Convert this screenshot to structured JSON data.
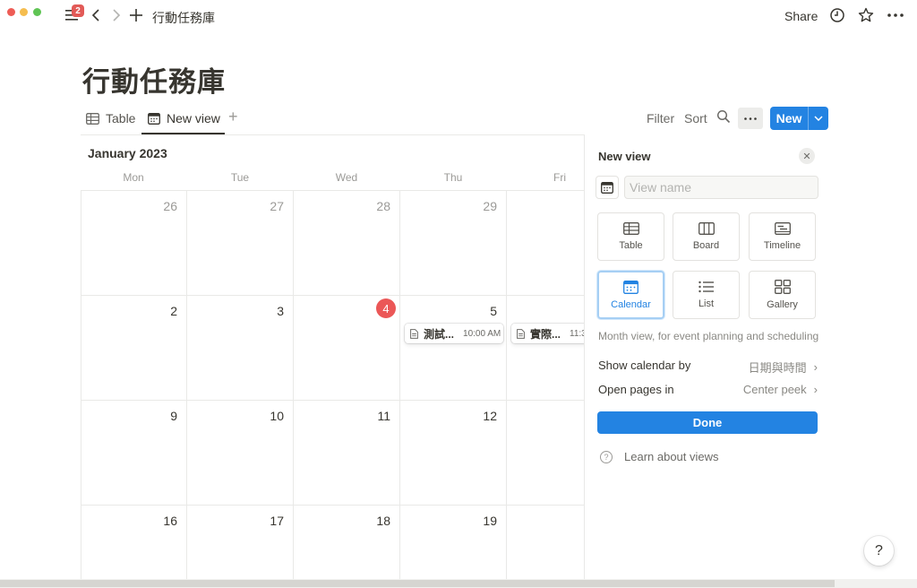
{
  "window": {
    "notification_count": "2",
    "breadcrumb": "行動任務庫",
    "share_label": "Share"
  },
  "page": {
    "title": "行動任務庫"
  },
  "views": {
    "tabs": [
      {
        "label": "Table",
        "icon": "table-icon"
      },
      {
        "label": "New view",
        "icon": "calendar-icon",
        "active": true
      }
    ],
    "filter_label": "Filter",
    "sort_label": "Sort",
    "new_label": "New"
  },
  "calendar": {
    "month": "January 2023",
    "weekdays": [
      "Mon",
      "Tue",
      "Wed",
      "Thu",
      "Fri"
    ],
    "weeks": [
      [
        "26",
        "27",
        "28",
        "29",
        ""
      ],
      [
        "2",
        "3",
        "4",
        "5",
        ""
      ],
      [
        "9",
        "10",
        "11",
        "12",
        ""
      ],
      [
        "16",
        "17",
        "18",
        "19",
        ""
      ]
    ],
    "today": "4",
    "events": [
      {
        "name": "測試...",
        "time": "10:00 AM"
      },
      {
        "name": "實際...",
        "time": "11:3"
      }
    ]
  },
  "panel": {
    "title": "New view",
    "name_placeholder": "View name",
    "layouts": [
      {
        "label": "Table",
        "icon": "table-icon"
      },
      {
        "label": "Board",
        "icon": "board-icon"
      },
      {
        "label": "Timeline",
        "icon": "timeline-icon"
      },
      {
        "label": "Calendar",
        "icon": "calendar-icon",
        "selected": true
      },
      {
        "label": "List",
        "icon": "list-icon"
      },
      {
        "label": "Gallery",
        "icon": "gallery-icon"
      }
    ],
    "description": "Month view, for event planning and scheduling",
    "show_calendar_by_label": "Show calendar by",
    "show_calendar_by_value": "日期與時間",
    "open_pages_in_label": "Open pages in",
    "open_pages_in_value": "Center peek",
    "done_label": "Done",
    "learn_label": "Learn about views"
  },
  "help": {
    "label": "?"
  },
  "colors": {
    "accent": "#2383e2",
    "today": "#eb5757",
    "badge": "#e25a57"
  }
}
